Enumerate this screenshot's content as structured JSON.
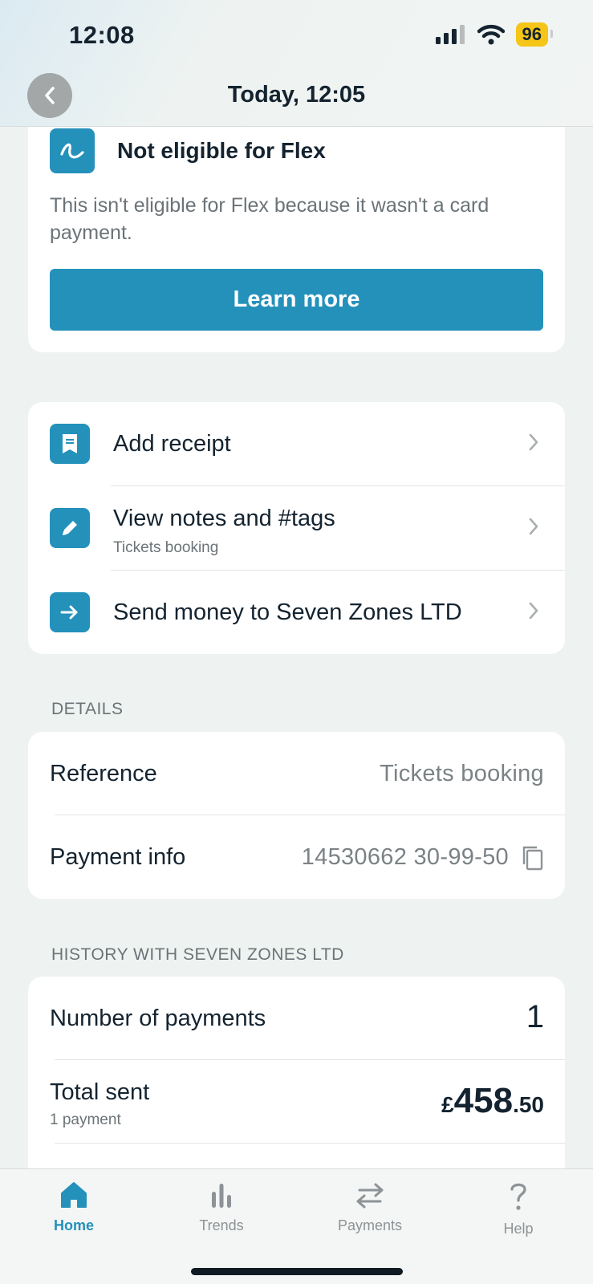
{
  "status_bar": {
    "time": "12:08",
    "battery": "96"
  },
  "header": {
    "title": "Today, 12:05"
  },
  "flex_card": {
    "title": "Not eligible for Flex",
    "description": "This isn't eligible for Flex because it wasn't a card payment.",
    "button_label": "Learn more"
  },
  "actions": [
    {
      "label": "Add receipt",
      "icon": "receipt-icon"
    },
    {
      "label": "View notes and #tags",
      "sublabel": "Tickets booking",
      "icon": "pencil-icon"
    },
    {
      "label": "Send money to Seven Zones LTD",
      "icon": "arrow-right-icon"
    }
  ],
  "details": {
    "heading": "DETAILS",
    "rows": [
      {
        "key": "Reference",
        "value": "Tickets booking"
      },
      {
        "key": "Payment info",
        "value": "14530662 30-99-50"
      }
    ]
  },
  "history": {
    "heading": "HISTORY WITH SEVEN ZONES LTD",
    "payments_label": "Number of payments",
    "payments_count": "1",
    "total_label": "Total sent",
    "total_sub": "1 payment",
    "total_currency": "£",
    "total_whole": "458",
    "total_decimal": ".50"
  },
  "tabbar": {
    "tabs": [
      {
        "label": "Home",
        "active": true
      },
      {
        "label": "Trends",
        "active": false
      },
      {
        "label": "Payments",
        "active": false
      },
      {
        "label": "Help",
        "active": false
      }
    ]
  },
  "colors": {
    "accent": "#2491bb",
    "battery": "#f5c518",
    "background": "#eef3f1"
  }
}
